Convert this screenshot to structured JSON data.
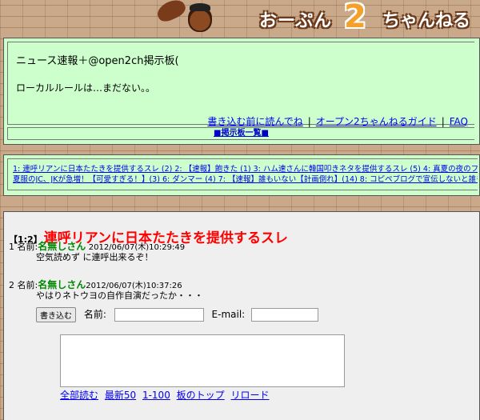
{
  "header": {
    "logo_text_left": "おーぷん",
    "logo_two": "2",
    "logo_text_right": "ちゃんねる"
  },
  "board": {
    "title": "ニュース速報＋@open2ch掲示板(",
    "local_rule": "ローカルルールは…まだない。。",
    "links": [
      {
        "label": "書き込む前に読んでね"
      },
      {
        "label": "オープン2ちゃんねるガイド"
      },
      {
        "label": "FAQ"
      }
    ],
    "separator": "|",
    "board_list": "■掲示板一覧■"
  },
  "thread_list": {
    "line1": "1: 連呼リアンに日本たたきを提供するスレ (2)  2: 【速報】飽きた (1)  3: ハム速さんに韓国叩きネタを提供するスレ (5)  4: 真夏の夜のフルブ 第",
    "line2": "夏服のJC、JKが急増！【可愛すぎる！】(3)  6: ダンマー (4)  7: 【速報】誰もいない【計画倒れ】(14)  8: コピペブログで宣伝しないと誰もこない"
  },
  "thread": {
    "range": "【1:2】",
    "title": "連呼リアンに日本たたきを提供するスレ",
    "posts": [
      {
        "num": "1",
        "name_label": "名前:",
        "name": "名無しさん",
        "date": "2012/06/07(木)10:29:49",
        "body": "空気読めず に連呼出来るぞ！"
      },
      {
        "num": "2",
        "name_label": "名前:",
        "name": "名無しさん",
        "date": "2012/06/07(木)10:37:26",
        "body": "やはりネトウヨの自作自演だったか・・・"
      }
    ]
  },
  "form": {
    "submit_label": "書き込む",
    "name_label": "名前:",
    "email_label": "E-mail:",
    "name_value": "",
    "email_value": "",
    "message_value": ""
  },
  "footer_links": [
    {
      "label": "全部読む"
    },
    {
      "label": "最新50"
    },
    {
      "label": "1-100"
    },
    {
      "label": "板のトップ"
    },
    {
      "label": "リロード"
    }
  ]
}
